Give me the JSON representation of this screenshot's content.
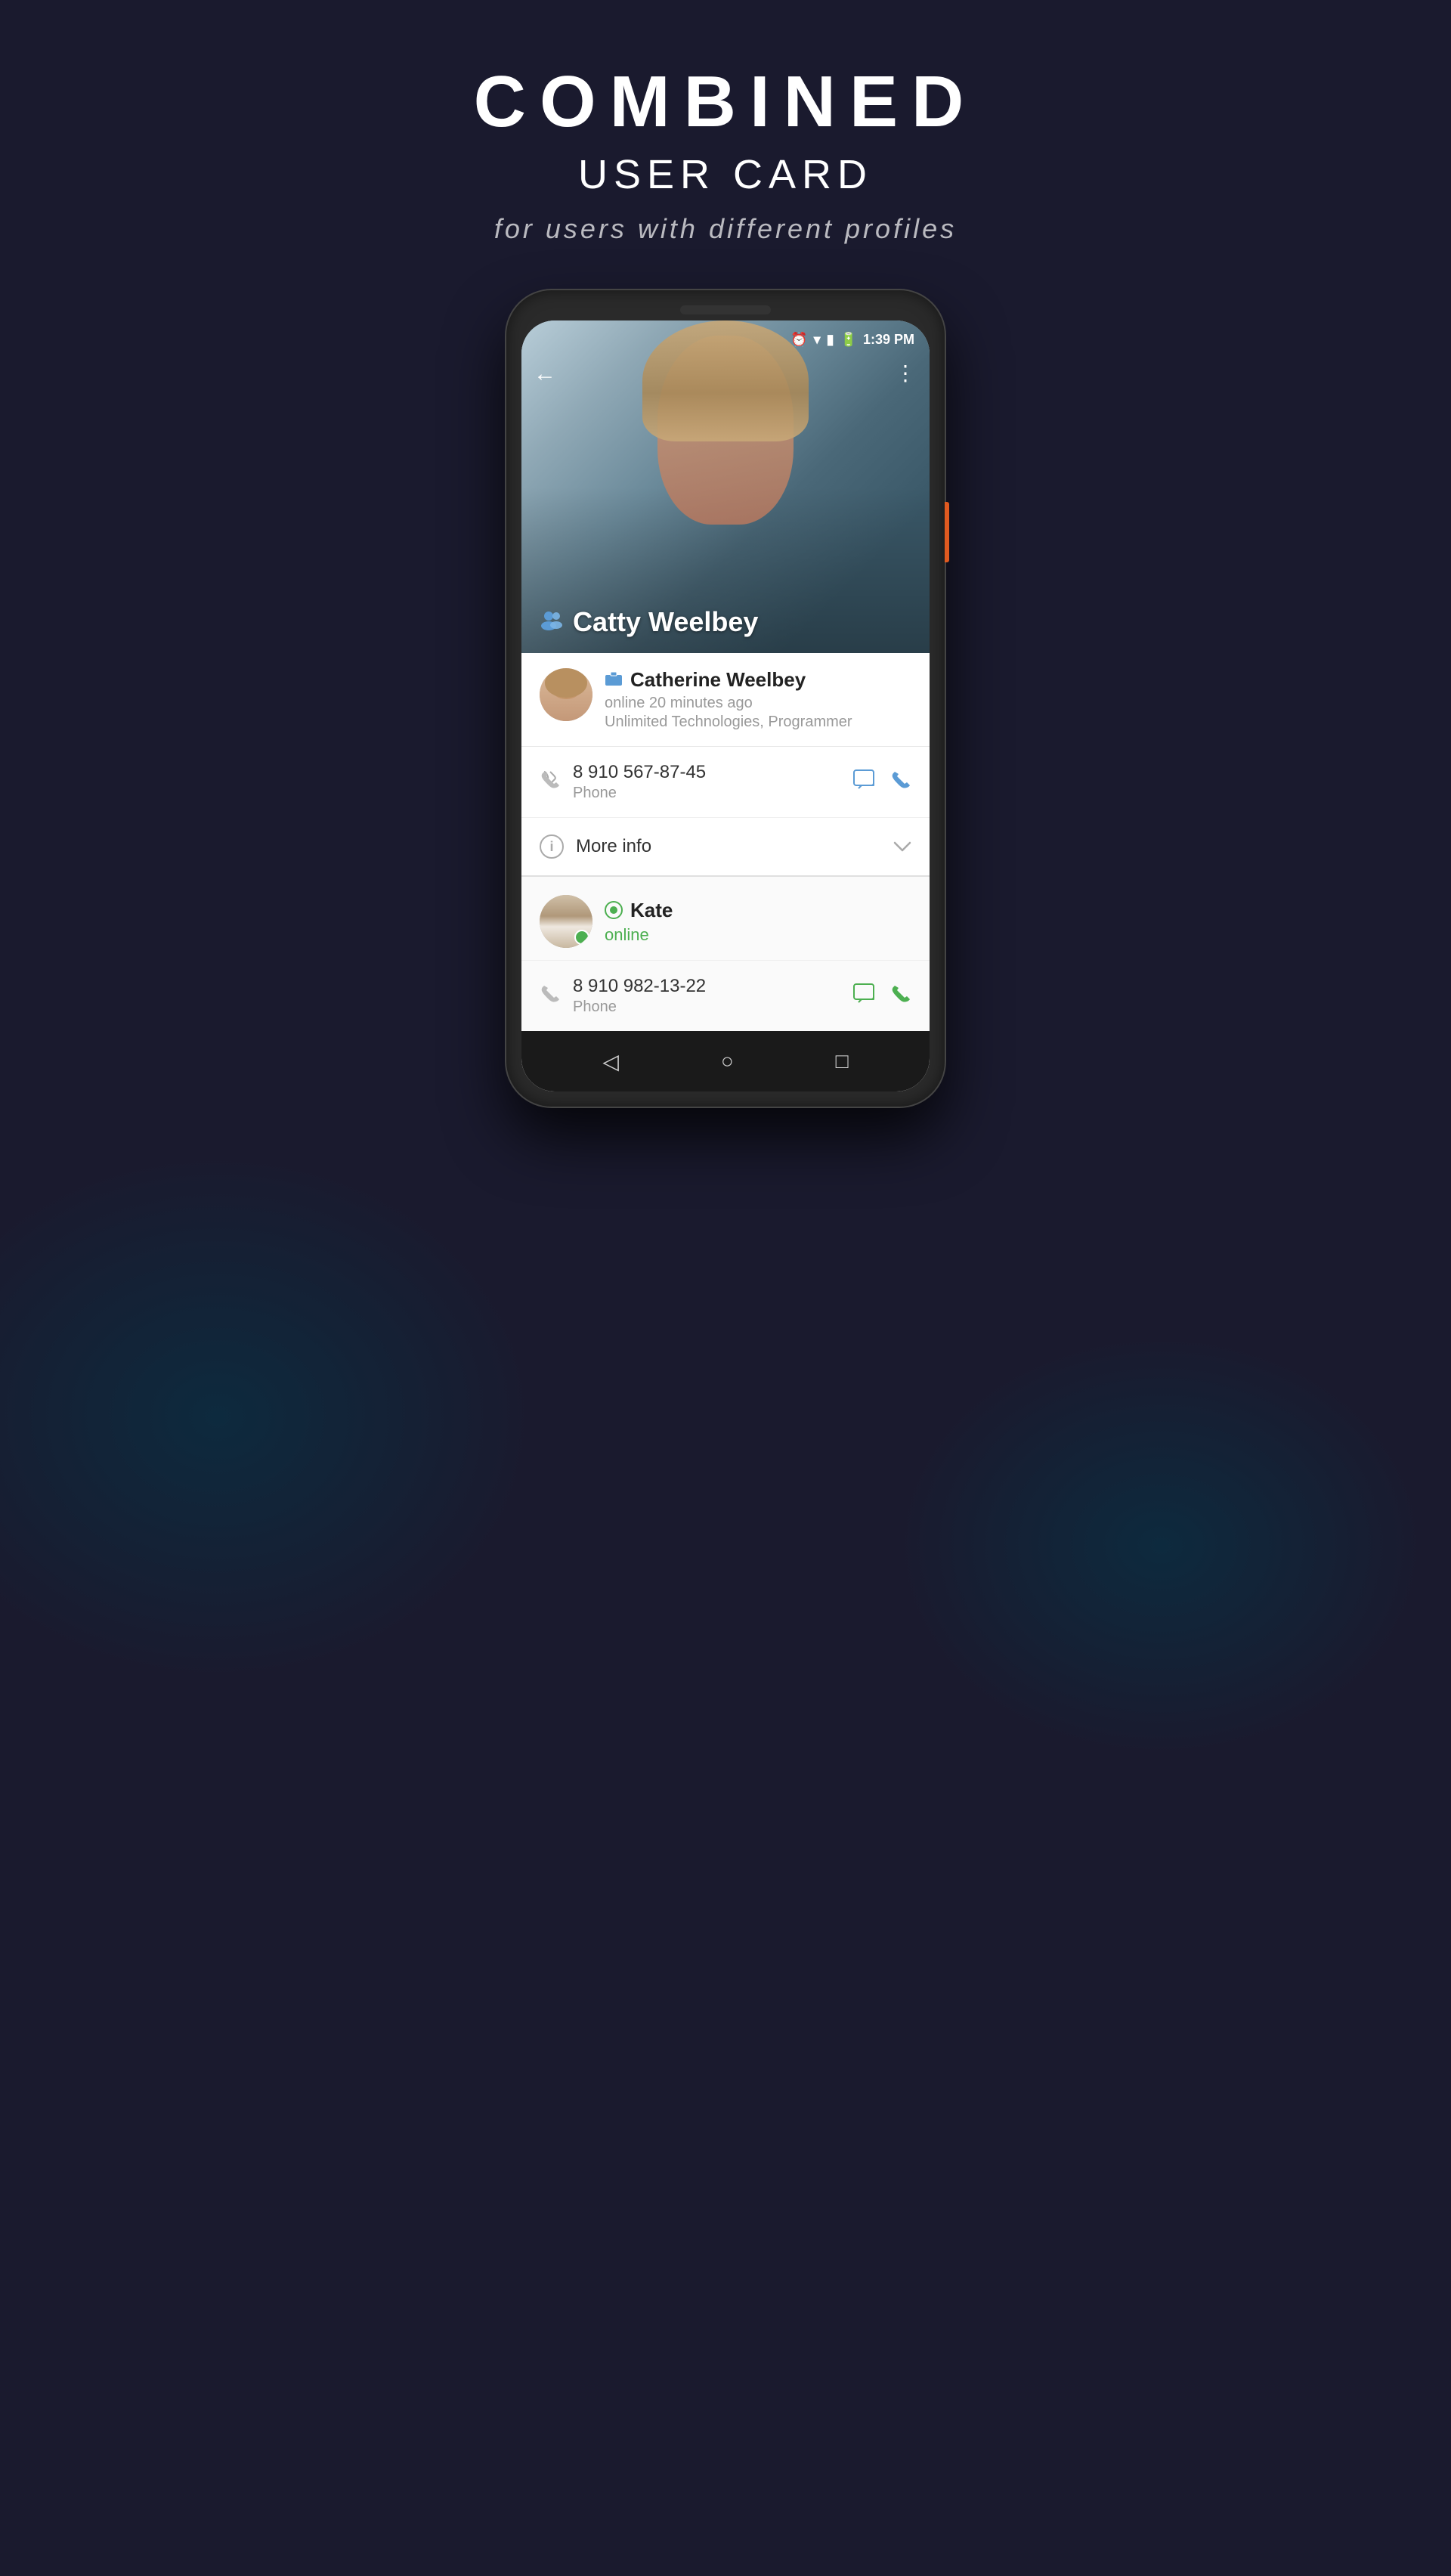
{
  "page": {
    "title_main": "COMBINED",
    "title_sub": "USER CARD",
    "title_desc": "for users with different profiles"
  },
  "status_bar": {
    "time": "1:39 PM"
  },
  "hero": {
    "user_name": "Catty Weelbey"
  },
  "contact1": {
    "name": "Catherine Weelbey",
    "status": "online 20 minutes ago",
    "company": "Unlimited Technologies, Programmer",
    "phone": "8 910 567-87-45",
    "phone_label": "Phone"
  },
  "more_info": {
    "label": "More info"
  },
  "contact2": {
    "name": "Kate",
    "status": "online",
    "phone": "8 910 982-13-22",
    "phone_label": "Phone"
  },
  "nav": {
    "back_label": "←",
    "menu_label": "⋮",
    "nav_back": "◁",
    "nav_home": "○",
    "nav_square": "□"
  }
}
